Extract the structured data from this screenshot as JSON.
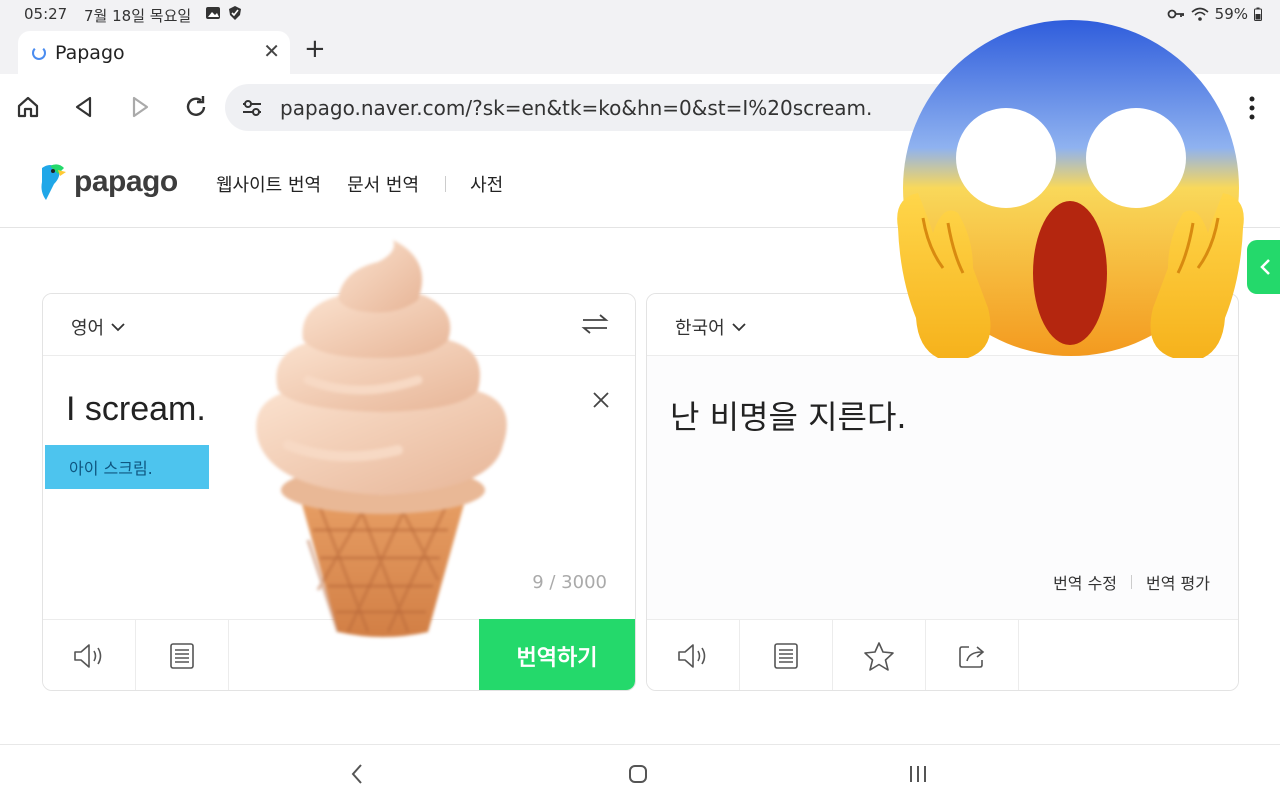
{
  "status_bar": {
    "time": "05:27",
    "date": "7월 18일 목요일",
    "battery": "59%",
    "icons": [
      "gallery-icon",
      "shield-check-icon",
      "key-icon",
      "wifi-icon",
      "battery-icon"
    ]
  },
  "browser": {
    "tab": {
      "title": "Papago"
    },
    "url": "papago.naver.com/?sk=en&tk=ko&hn=0&st=I%20scream.",
    "icons": [
      "home-icon",
      "back-icon",
      "forward-icon",
      "reload-icon",
      "site-settings-icon",
      "menu-icon"
    ]
  },
  "site": {
    "logo_text": "papago",
    "nav": [
      {
        "label": "웹사이트 번역"
      },
      {
        "label": "문서 번역"
      },
      {
        "label": "사전"
      }
    ]
  },
  "source_panel": {
    "language": "영어",
    "text": "I scream.",
    "pronunciation": "아이 스크림.",
    "char_count": "9 / 3000",
    "translate_button": "번역하기"
  },
  "target_panel": {
    "language": "한국어",
    "text": "난 비명을 지른다.",
    "edit_link": "번역 수정",
    "rate_link": "번역 평가"
  },
  "colors": {
    "brand_green": "#24d96b",
    "pronunciation_highlight": "#4dc4ee",
    "chrome_background": "#f2f2f4"
  },
  "overlays": [
    "soft-serve-ice-cream-emoji",
    "screaming-face-emoji"
  ]
}
